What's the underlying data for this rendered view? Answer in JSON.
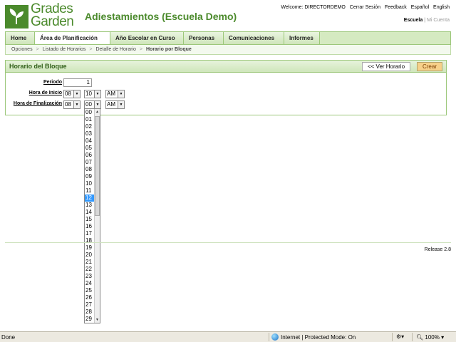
{
  "brand": {
    "line1": "Grades",
    "line2": "Garden"
  },
  "header": {
    "title": "Adiestamientos (Escuela Demo)",
    "welcome": "Welcome: DIRECTORDEMO",
    "links": [
      "Cerrar Sesión",
      "Feedback",
      "Español",
      "English"
    ],
    "scope_active": "Escuela",
    "scope_inactive": "Mi Cuenta"
  },
  "nav": {
    "items": [
      "Home",
      "Área de Planificación",
      "Año Escolar en Curso",
      "Personas",
      "Comunicaciones",
      "Informes"
    ],
    "active": "Área de Planificación"
  },
  "breadcrumb": [
    "Opciones",
    "Listado de Horarios",
    "Detalle de Horario",
    "Horario por Bloque"
  ],
  "panel": {
    "title": "Horario del Bloque",
    "back_button": "<< Ver Horario",
    "create_button": "Crear"
  },
  "form": {
    "periodo_label": "Periodo",
    "periodo_value": "1",
    "inicio_label": "Hora de Inicio",
    "inicio_hour": "08",
    "inicio_min": "10",
    "inicio_ampm": "AM",
    "fin_label": "Hora de Finalización",
    "fin_hour": "08",
    "fin_min": "00",
    "fin_ampm": "AM"
  },
  "dropdown": {
    "options": [
      "00",
      "01",
      "02",
      "03",
      "04",
      "05",
      "06",
      "07",
      "08",
      "09",
      "10",
      "11",
      "12",
      "13",
      "14",
      "15",
      "16",
      "17",
      "18",
      "19",
      "20",
      "21",
      "22",
      "23",
      "24",
      "25",
      "26",
      "27",
      "28",
      "29"
    ],
    "selected": "12"
  },
  "footer": {
    "release": "Release 2.8"
  },
  "statusbar": {
    "left": "Done",
    "zone": "Internet | Protected Mode: On",
    "zoom": "100%"
  }
}
